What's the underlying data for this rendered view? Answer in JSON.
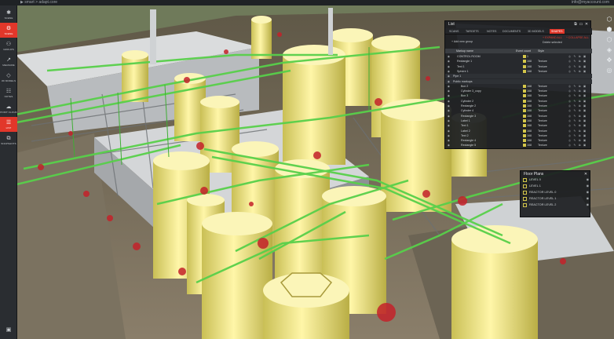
{
  "topbar": {
    "crumb": "▶ smart > adapt.core",
    "account": "info@myaccount.com"
  },
  "leftbar": {
    "items": [
      {
        "icon": "✱",
        "label": "scene",
        "active": false
      },
      {
        "icon": "⚙",
        "label": "scene",
        "active": true
      },
      {
        "icon": "⚇",
        "label": "groups",
        "active": false
      },
      {
        "icon": "↗",
        "label": "measure",
        "active": false
      },
      {
        "icon": "◇",
        "label": "3d models",
        "active": false
      },
      {
        "icon": "☷",
        "label": "notes",
        "active": false
      },
      {
        "icon": "☁",
        "label": "point cloud",
        "active": false
      },
      {
        "icon": "☰",
        "label": "list",
        "active": true
      },
      {
        "icon": "⧉",
        "label": "snapshots",
        "active": false
      }
    ],
    "bottom_icon": "▣"
  },
  "rightbar": {
    "icons": [
      "⬡",
      "⬢",
      "⬡",
      "◈",
      "✥",
      "◎"
    ]
  },
  "list_panel": {
    "title": "List",
    "tabs": [
      {
        "label": "SCANS",
        "active": false
      },
      {
        "label": "TARGETS",
        "active": false
      },
      {
        "label": "NOTES",
        "active": false
      },
      {
        "label": "DOCUMENTS",
        "active": false
      },
      {
        "label": "3D MODELS",
        "active": false
      },
      {
        "label": "SHAPES",
        "active": true
      }
    ],
    "toolbar": {
      "add_group": "+ Add new group",
      "expand_all": "+ EXPAND ALL",
      "collapse_all": "^ COLLAPSE ALL",
      "delete_selected": "Delete selected"
    },
    "columns": {
      "name": "Markup name",
      "count": "Event count",
      "style": "Style"
    },
    "rows": [
      {
        "name": "CONTROL ROOM",
        "group": false,
        "indent": 1,
        "count": "1",
        "texture": ""
      },
      {
        "name": "Rectangle 1",
        "group": false,
        "indent": 1,
        "count": "168",
        "texture": "Texture"
      },
      {
        "name": "Text 1",
        "group": false,
        "indent": 1,
        "count": "168",
        "texture": "Texture"
      },
      {
        "name": "Sphere 1",
        "group": false,
        "indent": 1,
        "count": "168",
        "texture": "Texture"
      },
      {
        "name": "Pipe 1",
        "group": true,
        "indent": 0,
        "count": "",
        "texture": ""
      },
      {
        "name": "Public markups",
        "group": true,
        "indent": 0,
        "count": "",
        "texture": ""
      },
      {
        "name": "Box 2",
        "group": false,
        "indent": 2,
        "count": "168",
        "texture": "Texture"
      },
      {
        "name": "Cylinder 3_copy",
        "group": false,
        "indent": 2,
        "count": "168",
        "texture": "Texture"
      },
      {
        "name": "Box 3",
        "group": false,
        "indent": 2,
        "count": "168",
        "texture": "Texture"
      },
      {
        "name": "Cylinder 2",
        "group": false,
        "indent": 2,
        "count": "168",
        "texture": "Texture"
      },
      {
        "name": "Rectangle 2",
        "group": false,
        "indent": 2,
        "count": "168",
        "texture": "Texture"
      },
      {
        "name": "Cylinder 4",
        "group": false,
        "indent": 2,
        "count": "168",
        "texture": "Texture"
      },
      {
        "name": "Rectangle 3",
        "group": false,
        "indent": 2,
        "count": "168",
        "texture": "Texture"
      },
      {
        "name": "Label 1",
        "group": false,
        "indent": 2,
        "count": "168",
        "texture": "Texture"
      },
      {
        "name": "Text 1",
        "group": false,
        "indent": 2,
        "count": "168",
        "texture": "Texture"
      },
      {
        "name": "Label 2",
        "group": false,
        "indent": 2,
        "count": "168",
        "texture": "Texture"
      },
      {
        "name": "Text 2",
        "group": false,
        "indent": 2,
        "count": "168",
        "texture": "Texture"
      },
      {
        "name": "Rectangle 4",
        "group": false,
        "indent": 2,
        "count": "168",
        "texture": "Texture"
      },
      {
        "name": "Rectangle 5",
        "group": false,
        "indent": 2,
        "count": "168",
        "texture": "Texture"
      }
    ]
  },
  "floor_panel": {
    "title": "Floor Plans",
    "items": [
      "LEVEL 0",
      "LEVEL 1",
      "REACTOR LEVEL 0",
      "REACTOR LEVEL 1",
      "REACTOR LEVEL 2"
    ]
  },
  "colors": {
    "accent": "#e2372a",
    "tank": "#f1ea8c",
    "pipe": "#58d04a",
    "marker": "#c4222a",
    "structure": "#c9ccce"
  }
}
